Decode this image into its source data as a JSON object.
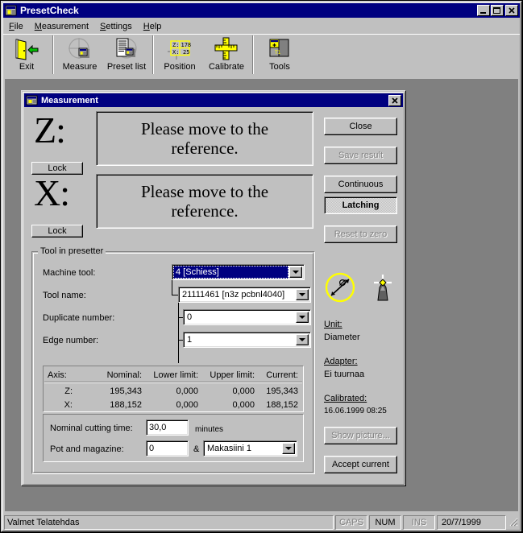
{
  "window": {
    "title": "PresetCheck",
    "icon": "app-icon",
    "buttons": {
      "minimize": "minimize",
      "maximize": "maximize",
      "close": "close"
    }
  },
  "menu": {
    "items": [
      {
        "label": "File",
        "accel": "F"
      },
      {
        "label": "Measurement",
        "accel": "M"
      },
      {
        "label": "Settings",
        "accel": "S"
      },
      {
        "label": "Help",
        "accel": "H"
      }
    ]
  },
  "toolbar": {
    "items": [
      {
        "label": "Exit",
        "icon": "exit-door-icon"
      },
      {
        "label": "Measure",
        "icon": "measure-crosshair-icon"
      },
      {
        "label": "Preset list",
        "icon": "preset-list-icon"
      },
      {
        "label": "Position",
        "icon": "position-readout-icon"
      },
      {
        "label": "Calibrate",
        "icon": "calibrate-ruler-icon"
      },
      {
        "label": "Tools",
        "icon": "tools-folder-icon"
      }
    ],
    "position_icon": {
      "z_label": "Z:",
      "z_value": "178",
      "x_label": "X:",
      "x_value": "25"
    },
    "tools_icon_text": "T1"
  },
  "dialog": {
    "title": "Measurement",
    "icon": "app-icon",
    "close_button": "close",
    "axes": [
      {
        "name": "Z:",
        "message": "Please move to the",
        "message2": "reference.",
        "lock_label": "Lock"
      },
      {
        "name": "X:",
        "message": "Please move to the",
        "message2": "reference.",
        "lock_label": "Lock"
      }
    ],
    "buttons": {
      "close": {
        "label": "Close",
        "enabled": true
      },
      "save_result": {
        "label": "Save result",
        "enabled": false
      },
      "continuous": {
        "label": "Continuous",
        "enabled": true,
        "pressed": false
      },
      "latching": {
        "label": "Latching",
        "enabled": true,
        "pressed": true
      },
      "reset_to_zero": {
        "label": "Reset to zero",
        "enabled": false
      },
      "show_picture": {
        "label": "Show picture...",
        "enabled": false
      },
      "accept_current": {
        "label": "Accept current",
        "enabled": true
      }
    },
    "group": {
      "title": "Tool in presetter",
      "fields": [
        {
          "label": "Machine tool:",
          "value": "4 [Schiess]",
          "selected": true
        },
        {
          "label": "Tool name:",
          "value": "21111461 [n3z    pcbnl4040]",
          "selected": false
        },
        {
          "label": "Duplicate number:",
          "value": "0",
          "selected": false
        },
        {
          "label": "Edge number:",
          "value": "1",
          "selected": false
        }
      ],
      "table": {
        "headers": [
          "Axis:",
          "Nominal:",
          "Lower limit:",
          "Upper limit:",
          "Current:"
        ],
        "rows": [
          [
            "Z:",
            "195,343",
            "0,000",
            "0,000",
            "195,343"
          ],
          [
            "X:",
            "188,152",
            "0,000",
            "0,000",
            "188,152"
          ]
        ]
      },
      "cutting_time": {
        "label": "Nominal cutting time:",
        "value": "30,0",
        "unit": "minutes"
      },
      "pot_magazine": {
        "label": "Pot and magazine:",
        "value": "0",
        "separator": "&",
        "magazine": "Makasiini 1"
      }
    },
    "info": {
      "unit": {
        "label": "Unit:",
        "value": "Diameter"
      },
      "adapter": {
        "label": "Adapter:",
        "value": "Ei tuurnaa"
      },
      "calibrated": {
        "label": "Calibrated:",
        "value": "16.06.1999 08:25"
      },
      "icons": {
        "diameter": "diameter-icon",
        "tool": "tool-tip-icon"
      }
    }
  },
  "statusbar": {
    "message": "Valmet Telatehdas",
    "indicators": [
      {
        "label": "CAPS",
        "active": false
      },
      {
        "label": "NUM",
        "active": true
      },
      {
        "label": "INS",
        "active": false
      }
    ],
    "date": "20/7/1999",
    "grip": "resize-grip"
  },
  "colors": {
    "titlebar": "#000080",
    "face": "#c0c0c0",
    "mdi_background": "#808080",
    "accent_yellow": "#ffff00",
    "accent_green": "#00b000",
    "disabled_text": "#808080"
  }
}
